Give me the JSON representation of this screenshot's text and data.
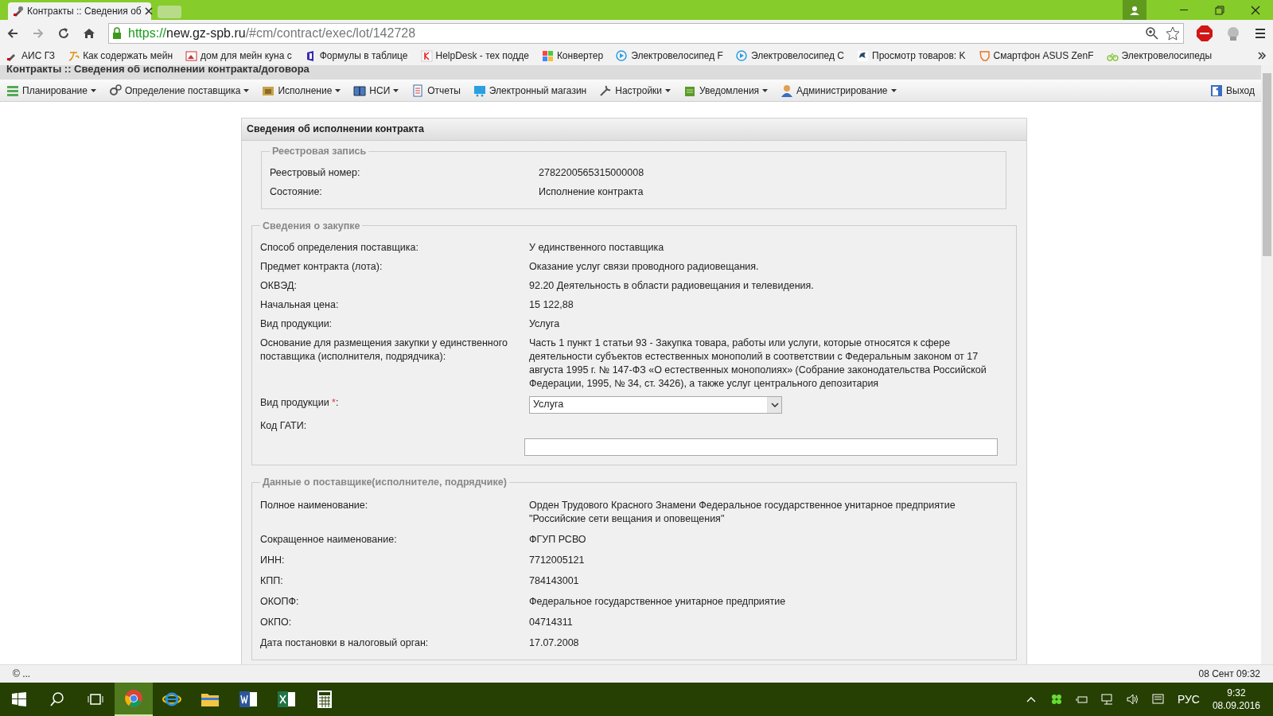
{
  "browser": {
    "tab_title": "Контракты :: Сведения об",
    "address": {
      "scheme": "https://",
      "host": "new.gz-spb.ru",
      "path": "/#cm/contract/exec/lot/142728"
    },
    "bookmarks": [
      "АИС ГЗ",
      "Как содержать мейн",
      "дом для мейн куна с",
      "Формулы в таблице",
      "HelpDesk - тех подде",
      "Конвертер",
      "Электровелосипед F",
      "Электровелосипед C",
      "Просмотр товаров: K",
      "Смартфон ASUS ZenF",
      "Электровелосипеды"
    ]
  },
  "page_title": "Контракты :: Сведения об исполнении контракта/договора",
  "menu": [
    {
      "label": "Планирование",
      "dropdown": true
    },
    {
      "label": "Определение поставщика",
      "dropdown": true
    },
    {
      "label": "Исполнение",
      "dropdown": true
    },
    {
      "label": "НСИ",
      "dropdown": true
    },
    {
      "label": "Отчеты",
      "dropdown": false
    },
    {
      "label": "Электронный магазин",
      "dropdown": false
    },
    {
      "label": "Настройки",
      "dropdown": true
    },
    {
      "label": "Уведомления",
      "dropdown": true
    },
    {
      "label": "Администрирование",
      "dropdown": true
    }
  ],
  "exit_label": "Выход",
  "form": {
    "title": "Сведения об исполнении контракта",
    "sections": [
      {
        "legend": "Реестровая запись",
        "rows": [
          {
            "kind": "text",
            "label": "Реестровый номер:",
            "value": "2782200565315000008"
          },
          {
            "kind": "text",
            "label": "Состояние:",
            "value": "Исполнение контракта"
          }
        ]
      },
      {
        "legend": "Сведения о закупке",
        "rows": [
          {
            "kind": "text",
            "label": "Способ определения поставщика:",
            "value": "У единственного поставщика"
          },
          {
            "kind": "text",
            "label": "Предмет контракта (лота):",
            "value": "Оказание услуг связи проводного радиовещания."
          },
          {
            "kind": "text",
            "label": "ОКВЭД:",
            "value": "92.20 Деятельность в области радиовещания и телевидения."
          },
          {
            "kind": "text",
            "label": "Начальная цена:",
            "value": "15 122,88"
          },
          {
            "kind": "text",
            "label": "Вид продукции:",
            "value": "Услуга"
          },
          {
            "kind": "text",
            "label": "Основание для размещения закупки у единственного поставщика (исполнителя, подрядчика):",
            "value": "Часть 1 пункт 1 статьи 93 - Закупка товара, работы или услуги, которые относятся к сфере деятельности субъектов естественных монополий в соответствии с Федеральным законом от 17 августа 1995 г. № 147-ФЗ «О естественных монополиях» (Собрание законодательства Российской Федерации, 1995, № 34, ст. 3426), а также услуг центрального депозитария"
          },
          {
            "kind": "select",
            "label": "Вид продукции",
            "required_mark": "*",
            "label_suffix": ":",
            "value": "Услуга"
          },
          {
            "kind": "input",
            "label": "Код ГАТИ:"
          }
        ]
      },
      {
        "legend": "Данные о поставщике(исполнителе, подрядчике)",
        "rows": [
          {
            "kind": "text",
            "label": "Полное наименование:",
            "value": "Орден Трудового Красного Знамени Федеральное государственное унитарное предприятие \"Российские сети вещания и оповещения\""
          },
          {
            "kind": "text",
            "label": "Сокращенное наименование:",
            "value": "ФГУП РСВО"
          },
          {
            "kind": "text",
            "label": "ИНН:",
            "value": "7712005121"
          },
          {
            "kind": "text",
            "label": "КПП:",
            "value": "784143001"
          },
          {
            "kind": "text",
            "label": "ОКОПФ:",
            "value": "Федеральное государственное унитарное предприятие"
          },
          {
            "kind": "text",
            "label": "ОКПО:",
            "value": "04714311"
          },
          {
            "kind": "text",
            "label": "Дата постановки в налоговый орган:",
            "value": "17.07.2008"
          }
        ]
      }
    ]
  },
  "status_bar": {
    "left": "© ...",
    "right": "08 Сент 09:32"
  },
  "taskbar": {
    "apps": [
      {
        "kind": "chrome",
        "selected": true
      },
      {
        "kind": "ie",
        "selected": false
      },
      {
        "kind": "explorer",
        "selected": false
      },
      {
        "kind": "word",
        "selected": false
      },
      {
        "kind": "excel",
        "selected": false
      },
      {
        "kind": "calculator",
        "selected": false
      }
    ],
    "language": "РУС",
    "time": "9:32",
    "date": "08.09.2016"
  }
}
